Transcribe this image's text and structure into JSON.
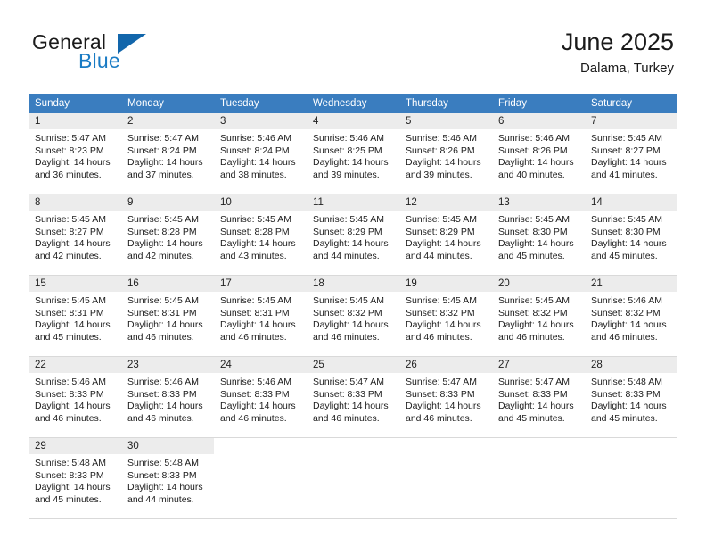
{
  "brand": {
    "line1": "General",
    "line2": "Blue",
    "triangle_icon": "brand-triangle-icon",
    "accent_color": "#1a7bc4",
    "triangle_color": "#1266ab"
  },
  "header": {
    "title": "June 2025",
    "subtitle": "Dalama, Turkey"
  },
  "calendar": {
    "header_bg": "#3a7dbf",
    "daynum_bg": "#ececec",
    "weekday_headers": [
      "Sunday",
      "Monday",
      "Tuesday",
      "Wednesday",
      "Thursday",
      "Friday",
      "Saturday"
    ],
    "weeks": [
      [
        {
          "day": "1",
          "sunrise": "Sunrise: 5:47 AM",
          "sunset": "Sunset: 8:23 PM",
          "daylight_line1": "Daylight: 14 hours",
          "daylight_line2": "and 36 minutes."
        },
        {
          "day": "2",
          "sunrise": "Sunrise: 5:47 AM",
          "sunset": "Sunset: 8:24 PM",
          "daylight_line1": "Daylight: 14 hours",
          "daylight_line2": "and 37 minutes."
        },
        {
          "day": "3",
          "sunrise": "Sunrise: 5:46 AM",
          "sunset": "Sunset: 8:24 PM",
          "daylight_line1": "Daylight: 14 hours",
          "daylight_line2": "and 38 minutes."
        },
        {
          "day": "4",
          "sunrise": "Sunrise: 5:46 AM",
          "sunset": "Sunset: 8:25 PM",
          "daylight_line1": "Daylight: 14 hours",
          "daylight_line2": "and 39 minutes."
        },
        {
          "day": "5",
          "sunrise": "Sunrise: 5:46 AM",
          "sunset": "Sunset: 8:26 PM",
          "daylight_line1": "Daylight: 14 hours",
          "daylight_line2": "and 39 minutes."
        },
        {
          "day": "6",
          "sunrise": "Sunrise: 5:46 AM",
          "sunset": "Sunset: 8:26 PM",
          "daylight_line1": "Daylight: 14 hours",
          "daylight_line2": "and 40 minutes."
        },
        {
          "day": "7",
          "sunrise": "Sunrise: 5:45 AM",
          "sunset": "Sunset: 8:27 PM",
          "daylight_line1": "Daylight: 14 hours",
          "daylight_line2": "and 41 minutes."
        }
      ],
      [
        {
          "day": "8",
          "sunrise": "Sunrise: 5:45 AM",
          "sunset": "Sunset: 8:27 PM",
          "daylight_line1": "Daylight: 14 hours",
          "daylight_line2": "and 42 minutes."
        },
        {
          "day": "9",
          "sunrise": "Sunrise: 5:45 AM",
          "sunset": "Sunset: 8:28 PM",
          "daylight_line1": "Daylight: 14 hours",
          "daylight_line2": "and 42 minutes."
        },
        {
          "day": "10",
          "sunrise": "Sunrise: 5:45 AM",
          "sunset": "Sunset: 8:28 PM",
          "daylight_line1": "Daylight: 14 hours",
          "daylight_line2": "and 43 minutes."
        },
        {
          "day": "11",
          "sunrise": "Sunrise: 5:45 AM",
          "sunset": "Sunset: 8:29 PM",
          "daylight_line1": "Daylight: 14 hours",
          "daylight_line2": "and 44 minutes."
        },
        {
          "day": "12",
          "sunrise": "Sunrise: 5:45 AM",
          "sunset": "Sunset: 8:29 PM",
          "daylight_line1": "Daylight: 14 hours",
          "daylight_line2": "and 44 minutes."
        },
        {
          "day": "13",
          "sunrise": "Sunrise: 5:45 AM",
          "sunset": "Sunset: 8:30 PM",
          "daylight_line1": "Daylight: 14 hours",
          "daylight_line2": "and 45 minutes."
        },
        {
          "day": "14",
          "sunrise": "Sunrise: 5:45 AM",
          "sunset": "Sunset: 8:30 PM",
          "daylight_line1": "Daylight: 14 hours",
          "daylight_line2": "and 45 minutes."
        }
      ],
      [
        {
          "day": "15",
          "sunrise": "Sunrise: 5:45 AM",
          "sunset": "Sunset: 8:31 PM",
          "daylight_line1": "Daylight: 14 hours",
          "daylight_line2": "and 45 minutes."
        },
        {
          "day": "16",
          "sunrise": "Sunrise: 5:45 AM",
          "sunset": "Sunset: 8:31 PM",
          "daylight_line1": "Daylight: 14 hours",
          "daylight_line2": "and 46 minutes."
        },
        {
          "day": "17",
          "sunrise": "Sunrise: 5:45 AM",
          "sunset": "Sunset: 8:31 PM",
          "daylight_line1": "Daylight: 14 hours",
          "daylight_line2": "and 46 minutes."
        },
        {
          "day": "18",
          "sunrise": "Sunrise: 5:45 AM",
          "sunset": "Sunset: 8:32 PM",
          "daylight_line1": "Daylight: 14 hours",
          "daylight_line2": "and 46 minutes."
        },
        {
          "day": "19",
          "sunrise": "Sunrise: 5:45 AM",
          "sunset": "Sunset: 8:32 PM",
          "daylight_line1": "Daylight: 14 hours",
          "daylight_line2": "and 46 minutes."
        },
        {
          "day": "20",
          "sunrise": "Sunrise: 5:45 AM",
          "sunset": "Sunset: 8:32 PM",
          "daylight_line1": "Daylight: 14 hours",
          "daylight_line2": "and 46 minutes."
        },
        {
          "day": "21",
          "sunrise": "Sunrise: 5:46 AM",
          "sunset": "Sunset: 8:32 PM",
          "daylight_line1": "Daylight: 14 hours",
          "daylight_line2": "and 46 minutes."
        }
      ],
      [
        {
          "day": "22",
          "sunrise": "Sunrise: 5:46 AM",
          "sunset": "Sunset: 8:33 PM",
          "daylight_line1": "Daylight: 14 hours",
          "daylight_line2": "and 46 minutes."
        },
        {
          "day": "23",
          "sunrise": "Sunrise: 5:46 AM",
          "sunset": "Sunset: 8:33 PM",
          "daylight_line1": "Daylight: 14 hours",
          "daylight_line2": "and 46 minutes."
        },
        {
          "day": "24",
          "sunrise": "Sunrise: 5:46 AM",
          "sunset": "Sunset: 8:33 PM",
          "daylight_line1": "Daylight: 14 hours",
          "daylight_line2": "and 46 minutes."
        },
        {
          "day": "25",
          "sunrise": "Sunrise: 5:47 AM",
          "sunset": "Sunset: 8:33 PM",
          "daylight_line1": "Daylight: 14 hours",
          "daylight_line2": "and 46 minutes."
        },
        {
          "day": "26",
          "sunrise": "Sunrise: 5:47 AM",
          "sunset": "Sunset: 8:33 PM",
          "daylight_line1": "Daylight: 14 hours",
          "daylight_line2": "and 46 minutes."
        },
        {
          "day": "27",
          "sunrise": "Sunrise: 5:47 AM",
          "sunset": "Sunset: 8:33 PM",
          "daylight_line1": "Daylight: 14 hours",
          "daylight_line2": "and 45 minutes."
        },
        {
          "day": "28",
          "sunrise": "Sunrise: 5:48 AM",
          "sunset": "Sunset: 8:33 PM",
          "daylight_line1": "Daylight: 14 hours",
          "daylight_line2": "and 45 minutes."
        }
      ],
      [
        {
          "day": "29",
          "sunrise": "Sunrise: 5:48 AM",
          "sunset": "Sunset: 8:33 PM",
          "daylight_line1": "Daylight: 14 hours",
          "daylight_line2": "and 45 minutes."
        },
        {
          "day": "30",
          "sunrise": "Sunrise: 5:48 AM",
          "sunset": "Sunset: 8:33 PM",
          "daylight_line1": "Daylight: 14 hours",
          "daylight_line2": "and 44 minutes."
        },
        {
          "day": "",
          "sunrise": "",
          "sunset": "",
          "daylight_line1": "",
          "daylight_line2": ""
        },
        {
          "day": "",
          "sunrise": "",
          "sunset": "",
          "daylight_line1": "",
          "daylight_line2": ""
        },
        {
          "day": "",
          "sunrise": "",
          "sunset": "",
          "daylight_line1": "",
          "daylight_line2": ""
        },
        {
          "day": "",
          "sunrise": "",
          "sunset": "",
          "daylight_line1": "",
          "daylight_line2": ""
        },
        {
          "day": "",
          "sunrise": "",
          "sunset": "",
          "daylight_line1": "",
          "daylight_line2": ""
        }
      ]
    ]
  }
}
